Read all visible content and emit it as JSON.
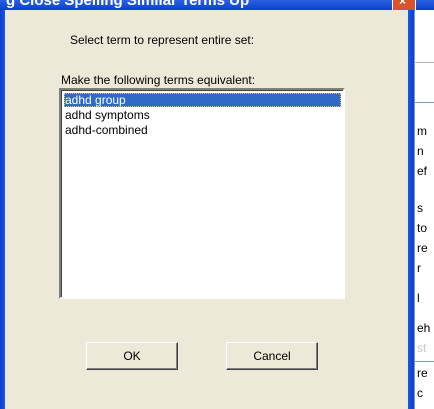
{
  "window": {
    "title": "g Close Spelling Similar Terms Up",
    "close_glyph": "×"
  },
  "dialog": {
    "heading": "Select term to represent entire set:",
    "list_label": "Make the following terms equivalent:",
    "terms": [
      "adhd group",
      "adhd symptoms",
      "adhd-combined"
    ],
    "selected_index": 0,
    "ok_label": "OK",
    "cancel_label": "Cancel"
  },
  "background_window": {
    "lines": [
      "m",
      "n",
      "ef",
      "s",
      "to",
      "re",
      "r",
      "l",
      "eh",
      "st",
      "re",
      "c"
    ]
  },
  "colors": {
    "selection": "#316ac5",
    "dialog_bg": "#ece9d8",
    "title_bar": "#0a3fd0"
  }
}
